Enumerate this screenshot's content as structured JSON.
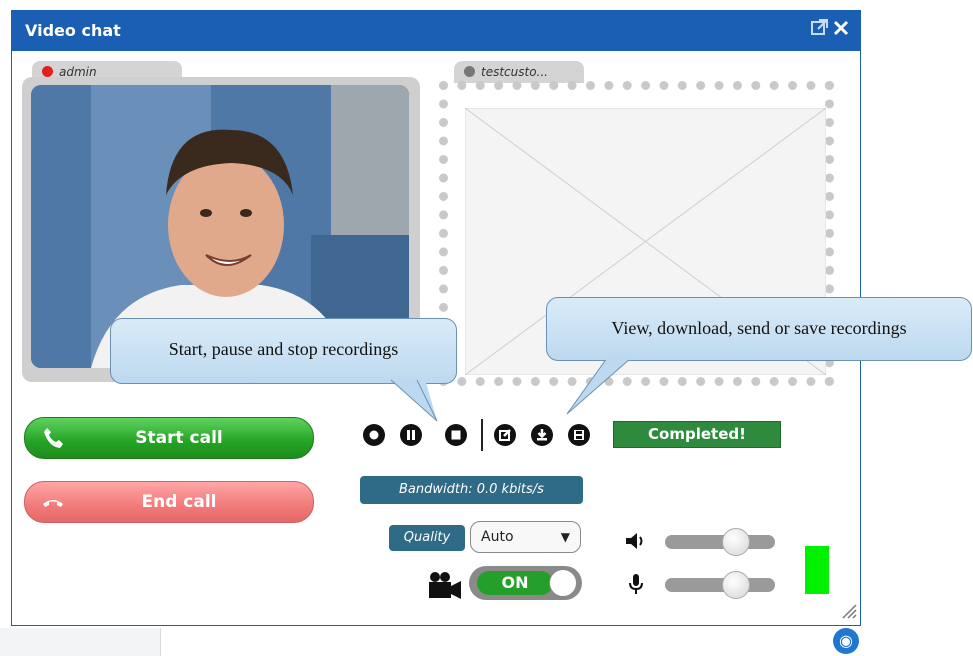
{
  "window": {
    "title": "Video chat"
  },
  "video": {
    "local_user": "admin",
    "remote_user": "testcusto..."
  },
  "buttons": {
    "start_call": "Start call",
    "end_call": "End call"
  },
  "recording": {
    "status": "Completed!",
    "controls": [
      "record-icon",
      "pause-icon",
      "stop-icon",
      "edit-icon",
      "download-icon",
      "save-icon"
    ]
  },
  "stats": {
    "bandwidth": "Bandwidth: 0.0 kbits/s"
  },
  "quality": {
    "label": "Quality",
    "selected": "Auto"
  },
  "camera_toggle": {
    "label": "ON",
    "state": true
  },
  "audio": {
    "speaker_volume": 0.7,
    "mic_volume": 0.7
  },
  "callouts": {
    "left": "Start, pause and stop recordings",
    "right": "View, download, send or save recordings"
  },
  "colors": {
    "title_bar": "#1a5fb4",
    "start_call": "#24a324",
    "end_call": "#f27a7a",
    "status_badge": "#2e8b3e",
    "info_badge": "#2f6a86",
    "level_meter": "#00f000",
    "local_indicator": "#e02020",
    "remote_indicator": "#777777"
  }
}
